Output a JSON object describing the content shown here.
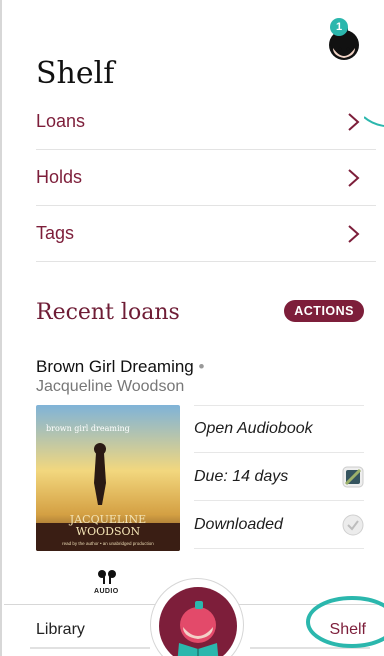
{
  "header": {
    "title": "Shelf",
    "notification_count": "1"
  },
  "menu": {
    "items": [
      {
        "label": "Loans"
      },
      {
        "label": "Holds"
      },
      {
        "label": "Tags"
      }
    ]
  },
  "recent": {
    "title": "Recent loans",
    "actions_label": "ACTIONS"
  },
  "book": {
    "title": "Brown Girl Dreaming",
    "author": "Jacqueline Woodson",
    "cover_title": "brown girl dreaming",
    "cover_author_line1": "JACQUELINE",
    "cover_author_line2": "WOODSON",
    "cover_caption": "read by the author • an unabridged production",
    "format_label": "AUDIO"
  },
  "book_actions": [
    {
      "label": "Open Audiobook"
    },
    {
      "label": "Due: 14 days"
    },
    {
      "label": "Downloaded"
    }
  ],
  "tabbar": {
    "left_label": "Library",
    "right_label": "Shelf"
  },
  "colors": {
    "brand": "#7d1e3a",
    "accent_teal": "#2bb7ad"
  }
}
